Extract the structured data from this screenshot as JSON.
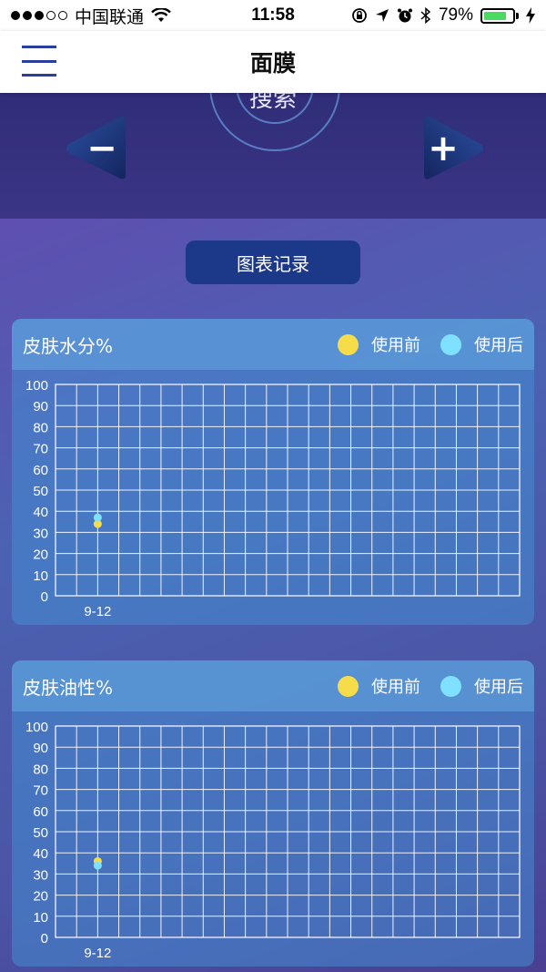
{
  "status_bar": {
    "carrier": "中国联通",
    "time": "11:58",
    "battery": "79%",
    "battery_level": 0.79
  },
  "navbar": {
    "title": "面膜",
    "menu_icon": "hamburger-menu-icon"
  },
  "controls": {
    "search_label": "搜索",
    "decrease_symbol": "−",
    "increase_symbol": "+"
  },
  "record_button_label": "图表记录",
  "colors": {
    "before": "#f5dc48",
    "after": "#7fe0ff",
    "button": "#1c3888"
  },
  "charts": [
    {
      "title": "皮肤水分%",
      "legend": {
        "before": "使用前",
        "after": "使用后"
      }
    },
    {
      "title": "皮肤油性%",
      "legend": {
        "before": "使用前",
        "after": "使用后"
      }
    }
  ],
  "chart_data": [
    {
      "type": "scatter",
      "title": "皮肤水分%",
      "xlabel": "",
      "ylabel": "",
      "ylim": [
        0,
        100
      ],
      "y_ticks": [
        0,
        10,
        20,
        30,
        40,
        50,
        60,
        70,
        80,
        90,
        100
      ],
      "x_ticks": [
        "9-12"
      ],
      "grid": true,
      "legend_position": "top-right",
      "series": [
        {
          "name": "使用前",
          "color": "#f5dc48",
          "points": [
            {
              "x": "9-12",
              "y": 34
            }
          ]
        },
        {
          "name": "使用后",
          "color": "#7fe0ff",
          "points": [
            {
              "x": "9-12",
              "y": 37
            }
          ]
        }
      ]
    },
    {
      "type": "scatter",
      "title": "皮肤油性%",
      "xlabel": "",
      "ylabel": "",
      "ylim": [
        0,
        100
      ],
      "y_ticks": [
        0,
        10,
        20,
        30,
        40,
        50,
        60,
        70,
        80,
        90,
        100
      ],
      "x_ticks": [
        "9-12"
      ],
      "grid": true,
      "legend_position": "top-right",
      "series": [
        {
          "name": "使用前",
          "color": "#f5dc48",
          "points": [
            {
              "x": "9-12",
              "y": 36
            }
          ]
        },
        {
          "name": "使用后",
          "color": "#7fe0ff",
          "points": [
            {
              "x": "9-12",
              "y": 34
            }
          ]
        }
      ]
    }
  ]
}
